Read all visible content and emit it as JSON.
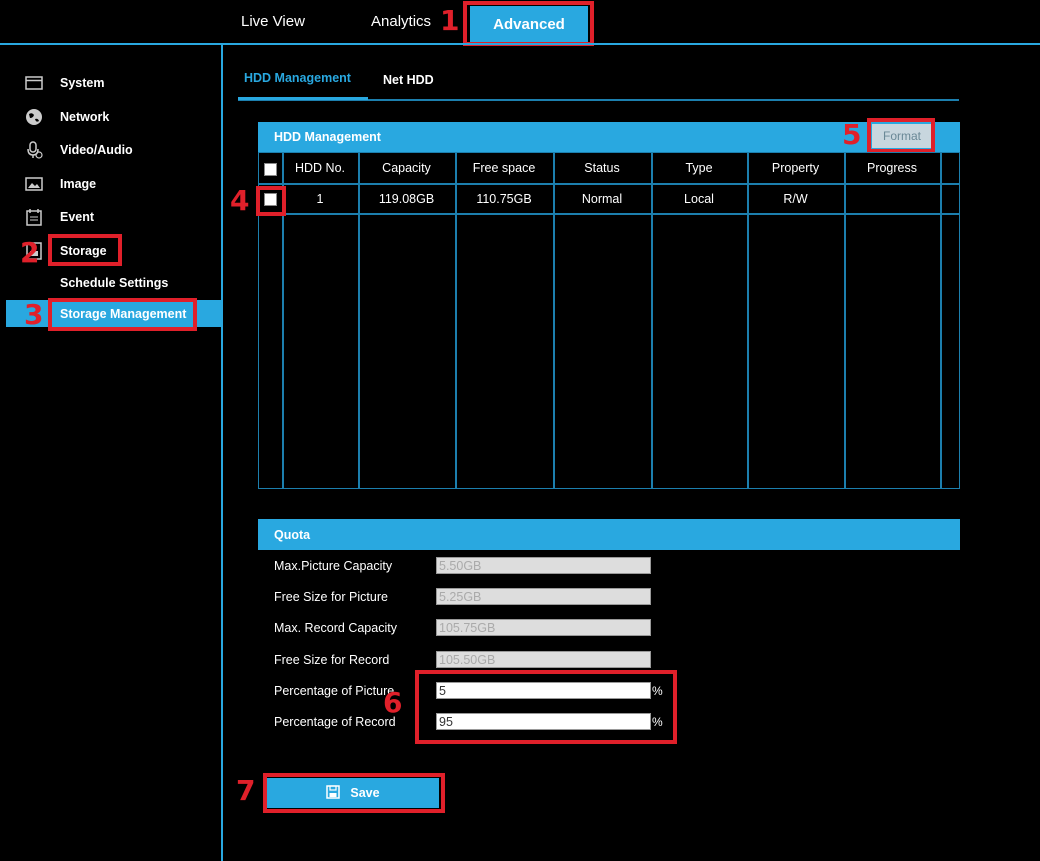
{
  "topnav": {
    "live_view": "Live View",
    "analytics": "Analytics",
    "advanced": "Advanced"
  },
  "annotations": [
    "1",
    "2",
    "3",
    "4",
    "5",
    "6",
    "7"
  ],
  "sidebar": {
    "items": [
      {
        "label": "System",
        "icon": "window-icon"
      },
      {
        "label": "Network",
        "icon": "globe-icon"
      },
      {
        "label": "Video/Audio",
        "icon": "microphone-icon"
      },
      {
        "label": "Image",
        "icon": "image-icon"
      },
      {
        "label": "Event",
        "icon": "calendar-icon"
      },
      {
        "label": "Storage",
        "icon": "storage-icon"
      }
    ],
    "sub_items": [
      "Schedule Settings",
      "Storage Management"
    ]
  },
  "subtabs": [
    "HDD Management",
    "Net HDD"
  ],
  "hdd": {
    "title": "HDD Management",
    "format_label": "Format",
    "columns": [
      "HDD No.",
      "Capacity",
      "Free space",
      "Status",
      "Type",
      "Property",
      "Progress"
    ],
    "rows": [
      [
        "1",
        "119.08GB",
        "110.75GB",
        "Normal",
        "Local",
        "R/W",
        ""
      ]
    ]
  },
  "quota": {
    "title": "Quota",
    "fields": [
      {
        "label": "Max.Picture Capacity",
        "value": "5.50GB"
      },
      {
        "label": "Free Size for Picture",
        "value": "5.25GB"
      },
      {
        "label": "Max. Record Capacity",
        "value": "105.75GB"
      },
      {
        "label": "Free Size for Record",
        "value": "105.50GB"
      },
      {
        "label": "Percentage of Picture",
        "value": "5",
        "unit": "%"
      },
      {
        "label": "Percentage of Record",
        "value": "95",
        "unit": "%"
      }
    ]
  },
  "save_label": "Save",
  "colors": {
    "accent": "#29a8e0",
    "highlight": "#e0202a",
    "background": "#000000"
  }
}
